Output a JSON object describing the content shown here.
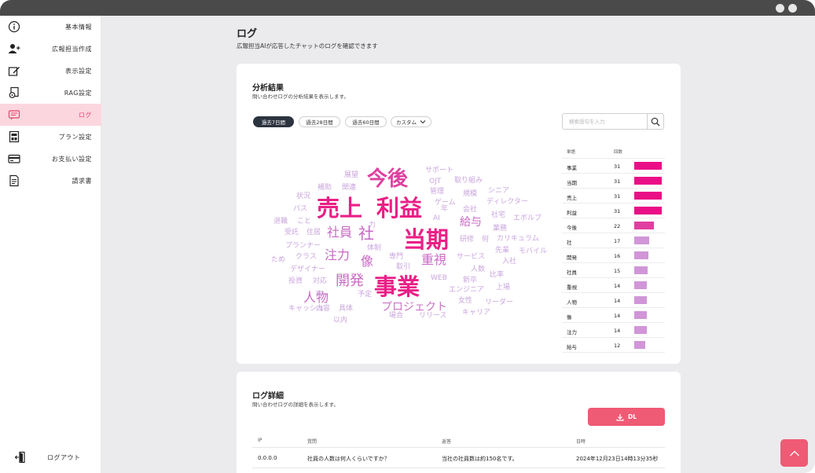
{
  "sidebar": {
    "items": [
      {
        "label": "基本情報",
        "icon": "info-icon"
      },
      {
        "label": "広報担当作成",
        "icon": "user-add-icon"
      },
      {
        "label": "表示設定",
        "icon": "edit-icon"
      },
      {
        "label": "RAG設定",
        "icon": "document-gear-icon"
      },
      {
        "label": "ログ",
        "icon": "chat-log-icon",
        "active": true
      },
      {
        "label": "プラン設定",
        "icon": "plan-icon"
      },
      {
        "label": "お支払い設定",
        "icon": "credit-card-icon"
      },
      {
        "label": "請求書",
        "icon": "invoice-icon"
      }
    ],
    "logout_label": "ログアウト"
  },
  "header": {
    "title": "ログ",
    "subtitle": "広報担当AIが応答したチャットのログを確認できます"
  },
  "analysis": {
    "title": "分析結果",
    "subtitle": "問い合わせログの分析結果を表示します。",
    "periods": [
      "過去7日間",
      "過去28日間",
      "過去60日間"
    ],
    "custom_label": "カスタム",
    "search_placeholder": "検索語句を入力",
    "table_headers": {
      "word": "単語",
      "count": "回数"
    },
    "word_counts": [
      {
        "word": "事業",
        "count": 31
      },
      {
        "word": "当期",
        "count": 31
      },
      {
        "word": "売上",
        "count": 31
      },
      {
        "word": "利益",
        "count": 31
      },
      {
        "word": "今後",
        "count": 22
      },
      {
        "word": "社",
        "count": 17
      },
      {
        "word": "開発",
        "count": 16
      },
      {
        "word": "社員",
        "count": 15
      },
      {
        "word": "重視",
        "count": 14
      },
      {
        "word": "人物",
        "count": 14
      },
      {
        "word": "像",
        "count": 14
      },
      {
        "word": "注力",
        "count": 14
      },
      {
        "word": "給与",
        "count": 12
      }
    ],
    "wordcloud": [
      {
        "t": "売上",
        "s": 29,
        "c": "#ea1f86"
      },
      {
        "t": "利益",
        "s": 29,
        "c": "#ea1f86"
      },
      {
        "t": "当期",
        "s": 29,
        "c": "#ea1f86"
      },
      {
        "t": "事業",
        "s": 29,
        "c": "#ea1f86"
      },
      {
        "t": "今後",
        "s": 26,
        "c": "#e040a0"
      },
      {
        "t": "社",
        "s": 20,
        "c": "#c965c2"
      },
      {
        "t": "社員",
        "s": 16,
        "c": "#c86ac4"
      },
      {
        "t": "開発",
        "s": 18,
        "c": "#c86ac4"
      },
      {
        "t": "重視",
        "s": 16,
        "c": "#c86ac4"
      },
      {
        "t": "人物",
        "s": 16,
        "c": "#c86ac4"
      },
      {
        "t": "像",
        "s": 16,
        "c": "#c86ac4"
      },
      {
        "t": "注力",
        "s": 16,
        "c": "#c86ac4"
      },
      {
        "t": "給与",
        "s": 14,
        "c": "#c86ac4"
      },
      {
        "t": "プロジェクト",
        "s": 14,
        "c": "#c874c4"
      },
      {
        "t": "展望",
        "s": 9,
        "c": "#c9a6dd"
      },
      {
        "t": "サポート",
        "s": 9,
        "c": "#c9a6dd"
      },
      {
        "t": "OJT",
        "s": 9,
        "c": "#c9a6dd"
      },
      {
        "t": "取り組み",
        "s": 9,
        "c": "#c9a6dd"
      },
      {
        "t": "補助",
        "s": 9,
        "c": "#c9a6dd"
      },
      {
        "t": "関連",
        "s": 9,
        "c": "#c9a6dd"
      },
      {
        "t": "管理",
        "s": 9,
        "c": "#c9a6dd"
      },
      {
        "t": "規模",
        "s": 9,
        "c": "#c9a6dd"
      },
      {
        "t": "シニア",
        "s": 9,
        "c": "#c9a6dd"
      },
      {
        "t": "状況",
        "s": 9,
        "c": "#c9a6dd"
      },
      {
        "t": "ゲーム",
        "s": 9,
        "c": "#c9a6dd"
      },
      {
        "t": "ディレクター",
        "s": 9,
        "c": "#c9a6dd"
      },
      {
        "t": "パス",
        "s": 9,
        "c": "#c9a6dd"
      },
      {
        "t": "年",
        "s": 9,
        "c": "#c9a6dd"
      },
      {
        "t": "会社",
        "s": 9,
        "c": "#c9a6dd"
      },
      {
        "t": "社宅",
        "s": 9,
        "c": "#c9a6dd"
      },
      {
        "t": "退職",
        "s": 9,
        "c": "#c9a6dd"
      },
      {
        "t": "こと",
        "s": 9,
        "c": "#c9a6dd"
      },
      {
        "t": "AI",
        "s": 9,
        "c": "#c9a6dd"
      },
      {
        "t": "エボルブ",
        "s": 9,
        "c": "#c9a6dd"
      },
      {
        "t": "受託",
        "s": 9,
        "c": "#c9a6dd"
      },
      {
        "t": "住居",
        "s": 9,
        "c": "#c9a6dd"
      },
      {
        "t": "力",
        "s": 9,
        "c": "#c9a6dd"
      },
      {
        "t": "業務",
        "s": 9,
        "c": "#c9a6dd"
      },
      {
        "t": "研修",
        "s": 9,
        "c": "#c9a6dd"
      },
      {
        "t": "何",
        "s": 9,
        "c": "#c9a6dd"
      },
      {
        "t": "カリキュラム",
        "s": 9,
        "c": "#c9a6dd"
      },
      {
        "t": "プランナー",
        "s": 9,
        "c": "#c9a6dd"
      },
      {
        "t": "体制",
        "s": 9,
        "c": "#c9a6dd"
      },
      {
        "t": "先輩",
        "s": 9,
        "c": "#c9a6dd"
      },
      {
        "t": "モバイル",
        "s": 9,
        "c": "#c9a6dd"
      },
      {
        "t": "クラス",
        "s": 9,
        "c": "#c9a6dd"
      },
      {
        "t": "専門",
        "s": 9,
        "c": "#c9a6dd"
      },
      {
        "t": "サービス",
        "s": 9,
        "c": "#c9a6dd"
      },
      {
        "t": "入社",
        "s": 9,
        "c": "#c9a6dd"
      },
      {
        "t": "ため",
        "s": 9,
        "c": "#c9a6dd"
      },
      {
        "t": "3",
        "s": 9,
        "c": "#c9a6dd"
      },
      {
        "t": "取引",
        "s": 9,
        "c": "#c9a6dd"
      },
      {
        "t": "人数",
        "s": 9,
        "c": "#c9a6dd"
      },
      {
        "t": "デザイナー",
        "s": 9,
        "c": "#c9a6dd"
      },
      {
        "t": "比率",
        "s": 9,
        "c": "#c9a6dd"
      },
      {
        "t": "投資",
        "s": 9,
        "c": "#c9a6dd"
      },
      {
        "t": "対応",
        "s": 9,
        "c": "#c9a6dd"
      },
      {
        "t": "WEB",
        "s": 9,
        "c": "#c9a6dd"
      },
      {
        "t": "新卒",
        "s": 9,
        "c": "#c9a6dd"
      },
      {
        "t": "上場",
        "s": 9,
        "c": "#c9a6dd"
      },
      {
        "t": "エンジニア",
        "s": 9,
        "c": "#c9a6dd"
      },
      {
        "t": "率",
        "s": 9,
        "c": "#c9a6dd"
      },
      {
        "t": "予定",
        "s": 9,
        "c": "#c9a6dd"
      },
      {
        "t": "女性",
        "s": 9,
        "c": "#c9a6dd"
      },
      {
        "t": "リーダー",
        "s": 9,
        "c": "#c9a6dd"
      },
      {
        "t": "キャッシュ",
        "s": 9,
        "c": "#c9a6dd"
      },
      {
        "t": "内容",
        "s": 9,
        "c": "#c9a6dd"
      },
      {
        "t": "具体",
        "s": 9,
        "c": "#c9a6dd"
      },
      {
        "t": "キャリア",
        "s": 9,
        "c": "#c9a6dd"
      },
      {
        "t": "場合",
        "s": 9,
        "c": "#c9a6dd"
      },
      {
        "t": "リリース",
        "s": 9,
        "c": "#c9a6dd"
      },
      {
        "t": "以内",
        "s": 9,
        "c": "#c9a6dd"
      }
    ]
  },
  "detail": {
    "title": "ログ詳細",
    "subtitle": "問い合わせログの詳細を表示します。",
    "dl_label": "DL",
    "columns": {
      "ip": "IP",
      "question": "質問",
      "answer": "返答",
      "datetime": "日時"
    },
    "rows": [
      {
        "ip": "0.0.0.0",
        "question": "社員の人数は何人くらいですか？",
        "answer": "当社の社員数は約150名です。",
        "datetime": "2024年12月23日14時13分35秒"
      }
    ]
  },
  "colors": {
    "accent": "#ef5a74",
    "active_bg": "#fcd6df",
    "bar_high": "#ea0f86",
    "bar_mid": "#e03fa0",
    "bar_low": "#d196d8"
  }
}
